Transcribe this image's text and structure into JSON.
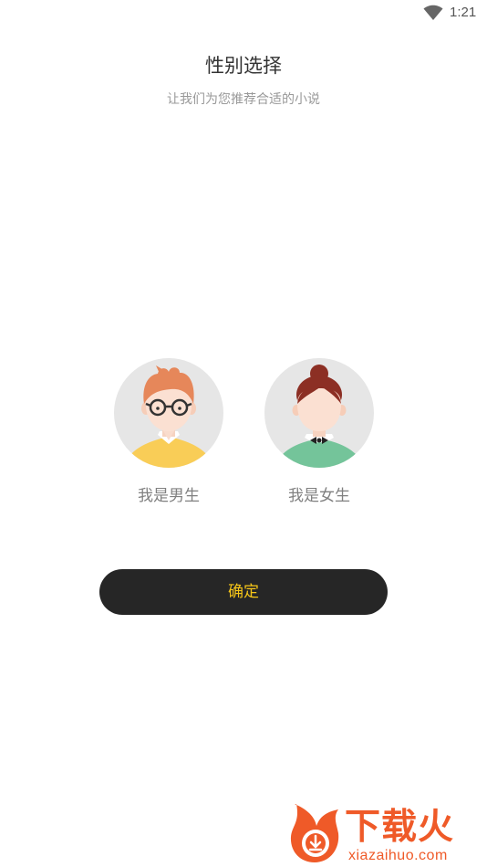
{
  "status_bar": {
    "time": "1:21",
    "wifi_icon": "wifi-icon"
  },
  "header": {
    "title": "性别选择",
    "subtitle": "让我们为您推荐合适的小说"
  },
  "options": [
    {
      "label": "我是男生",
      "icon": "male-avatar-icon",
      "shirt_color": "#f9cd57"
    },
    {
      "label": "我是女生",
      "icon": "female-avatar-icon",
      "shirt_color": "#74c49a"
    }
  ],
  "confirm": {
    "label": "确定",
    "bg_color": "#262626",
    "text_color": "#f5c518"
  },
  "watermark": {
    "title": "下载火",
    "url": "xiazaihuo.com",
    "color": "#ef5a28"
  }
}
